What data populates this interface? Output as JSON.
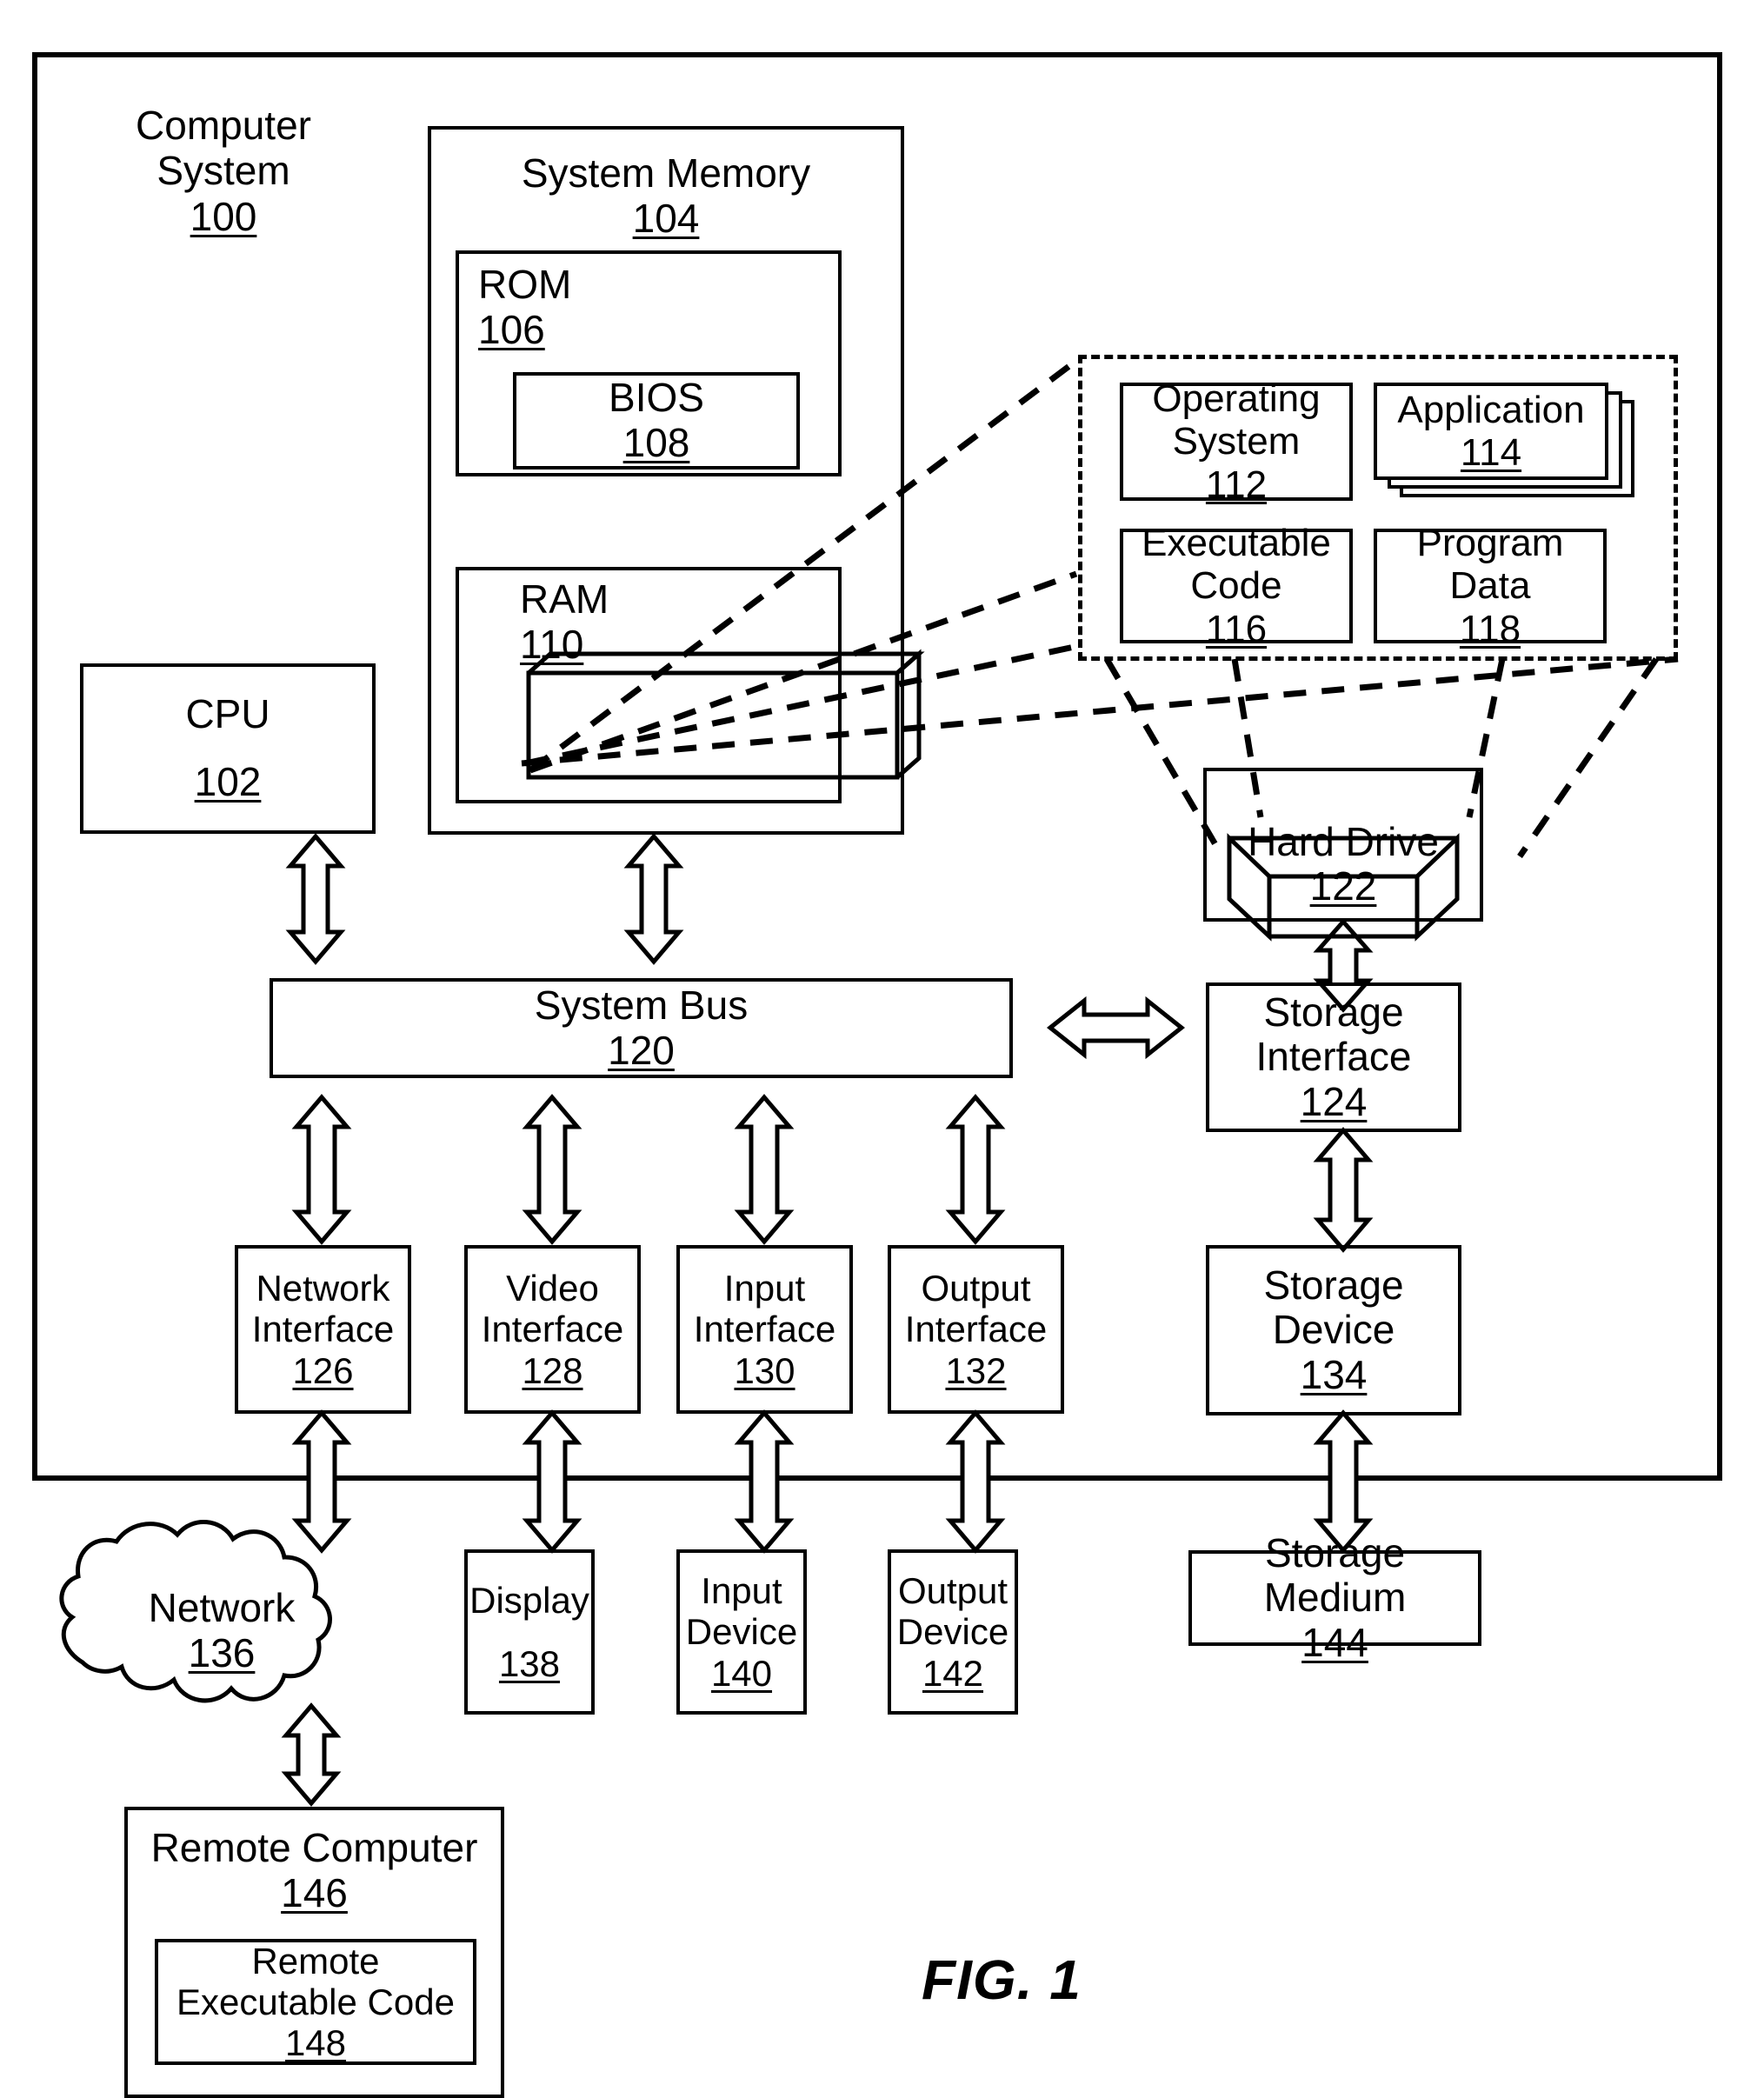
{
  "figure": {
    "caption": "FIG. 1",
    "outer": {
      "title": "Computer System",
      "number": "100"
    }
  },
  "blocks": {
    "system_memory": {
      "title": "System Memory",
      "number": "104"
    },
    "rom": {
      "title": "ROM",
      "number": "106"
    },
    "bios": {
      "title": "BIOS",
      "number": "108"
    },
    "ram": {
      "title": "RAM",
      "number": "110"
    },
    "cpu": {
      "title": "CPU",
      "number": "102"
    },
    "system_bus": {
      "title": "System Bus",
      "number": "120"
    },
    "operating_system": {
      "title": "Operating\nSystem",
      "number": "112"
    },
    "application": {
      "title": "Application",
      "number": "114"
    },
    "executable_code": {
      "title": "Executable\nCode",
      "number": "116"
    },
    "program_data": {
      "title": "Program\nData",
      "number": "118"
    },
    "hard_drive": {
      "title": "Hard Drive",
      "number": "122"
    },
    "storage_interface": {
      "title": "Storage\nInterface",
      "number": "124"
    },
    "storage_device": {
      "title": "Storage\nDevice",
      "number": "134"
    },
    "storage_medium": {
      "title": "Storage Medium",
      "number": "144"
    },
    "network_interface": {
      "title": "Network\nInterface",
      "number": "126"
    },
    "video_interface": {
      "title": "Video\nInterface",
      "number": "128"
    },
    "input_interface": {
      "title": "Input\nInterface",
      "number": "130"
    },
    "output_interface": {
      "title": "Output\nInterface",
      "number": "132"
    },
    "network": {
      "title": "Network",
      "number": "136"
    },
    "display": {
      "title": "Display",
      "number": "138"
    },
    "input_device": {
      "title": "Input\nDevice",
      "number": "140"
    },
    "output_device": {
      "title": "Output\nDevice",
      "number": "142"
    },
    "remote_computer": {
      "title": "Remote Computer",
      "number": "146"
    },
    "remote_executable_code": {
      "title": "Remote\nExecutable Code",
      "number": "148"
    }
  },
  "colors": {
    "stroke": "#000000",
    "background": "#ffffff"
  }
}
